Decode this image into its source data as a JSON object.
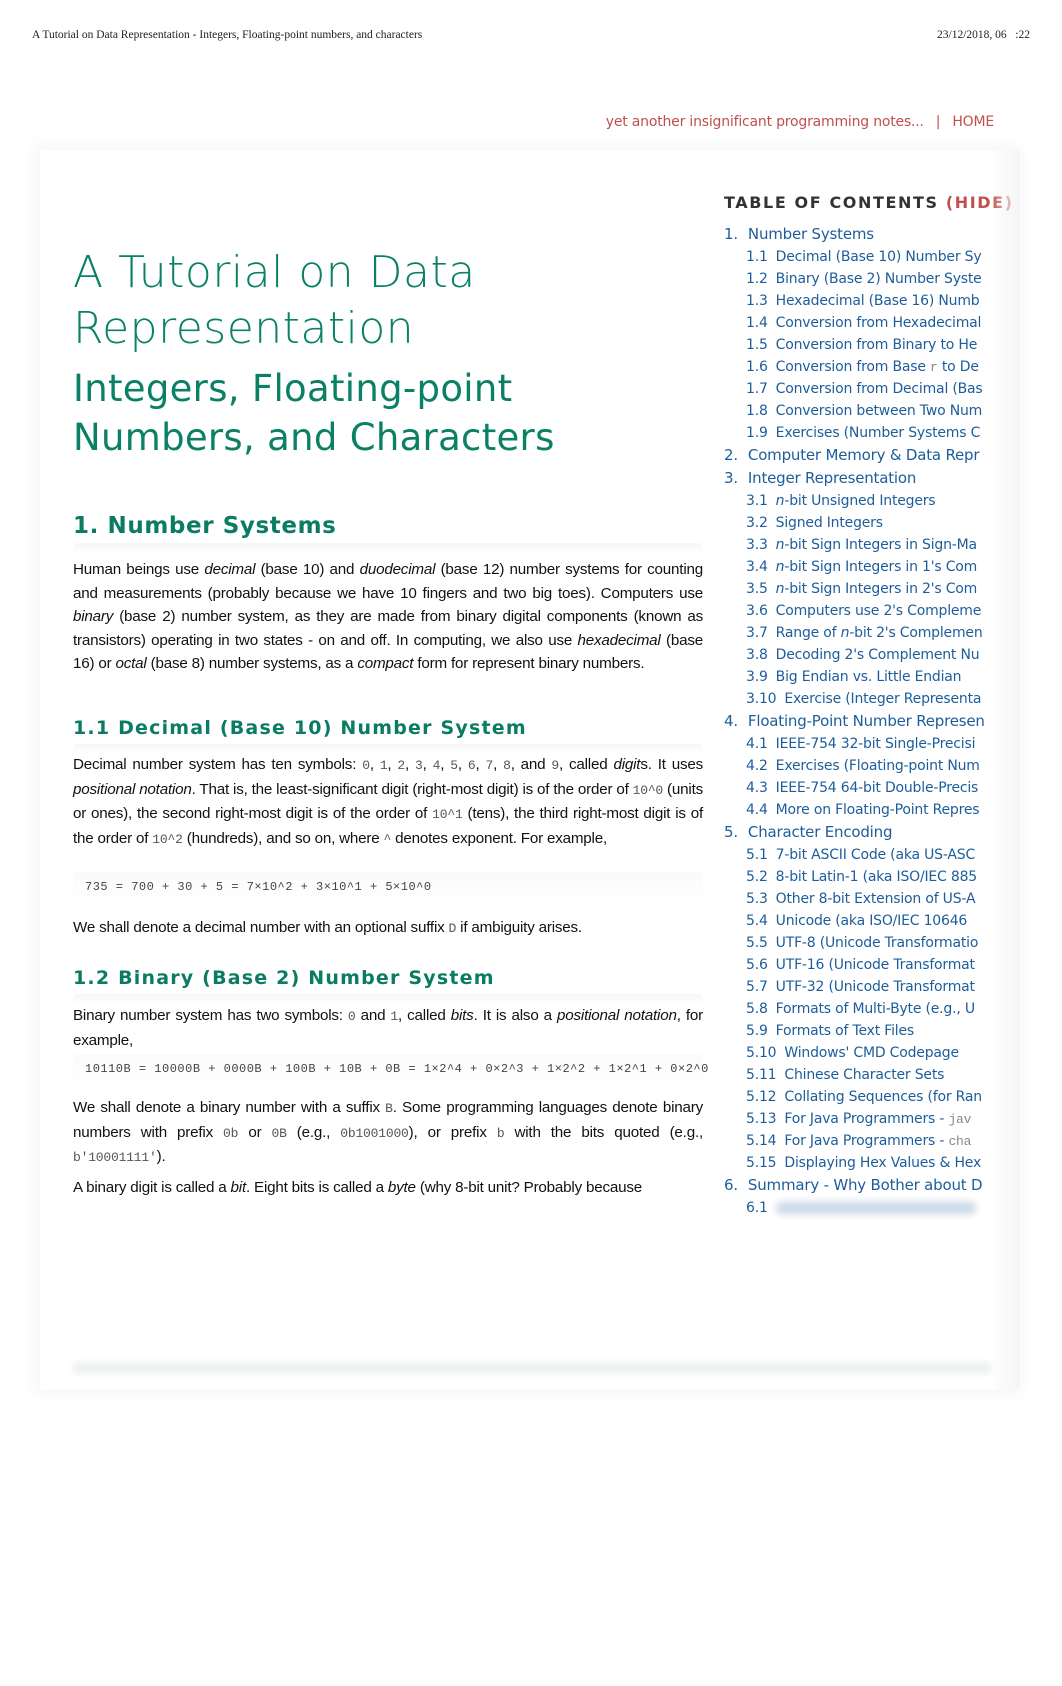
{
  "print_header": {
    "title": "A Tutorial on Data Representation - Integers, Floating-point numbers, and characters",
    "date": "23/12/2018, 06   :22"
  },
  "site_bar": {
    "tagline": "yet another insignificant programming notes...",
    "separator": "|",
    "home": "HOME"
  },
  "doc": {
    "title_line1": "A Tutorial on Data",
    "title_line2": "Representation",
    "subtitle_line1": "Integers, Floating-point",
    "subtitle_line2": "Numbers, and Characters"
  },
  "sections": {
    "s1": {
      "heading": "1.  Number Systems",
      "para": [
        {
          "t": "Human beings use "
        },
        {
          "i": "decimal"
        },
        {
          "t": " (base 10) and "
        },
        {
          "i": "duodecimal"
        },
        {
          "t": " (base 12) number systems for counting and measurements (probably because we have 10 fingers and two big toes). Computers use "
        },
        {
          "i": "binary"
        },
        {
          "t": " (base 2) number system, as they are made from binary digital components (known as transistors) operating in two states - on and off. In computing, we also use "
        },
        {
          "i": "hexadecimal"
        },
        {
          "t": " (base 16) or "
        },
        {
          "i": "octal"
        },
        {
          "t": " (base 8) number systems, as a "
        },
        {
          "i": "compact"
        },
        {
          "t": " form for represent binary numbers."
        }
      ]
    },
    "s1_1": {
      "heading": "1.1  Decimal (Base 10) Number System",
      "para": [
        {
          "t": "Decimal number system has ten symbols: "
        },
        {
          "c": "0"
        },
        {
          "t": ", "
        },
        {
          "c": "1"
        },
        {
          "t": ", "
        },
        {
          "c": "2"
        },
        {
          "t": ", "
        },
        {
          "c": "3"
        },
        {
          "t": ", "
        },
        {
          "c": "4"
        },
        {
          "t": ", "
        },
        {
          "c": "5"
        },
        {
          "t": ", "
        },
        {
          "c": "6"
        },
        {
          "t": ", "
        },
        {
          "c": "7"
        },
        {
          "t": ", "
        },
        {
          "c": "8"
        },
        {
          "t": ", and "
        },
        {
          "c": "9"
        },
        {
          "t": ", called "
        },
        {
          "i": "digit"
        },
        {
          "t": "s. It uses "
        },
        {
          "i": "positional notation"
        },
        {
          "t": ". That is, the least-significant digit (right-most digit) is of the order of "
        },
        {
          "c": "10^0"
        },
        {
          "t": " (units or ones), the second right-most digit is of the order of "
        },
        {
          "c": "10^1"
        },
        {
          "t": " (tens), the third right-most digit is of the order of "
        },
        {
          "c": "10^2"
        },
        {
          "t": " (hundreds), and so on, where "
        },
        {
          "c": "^"
        },
        {
          "t": " denotes exponent. For example,"
        }
      ],
      "code": "735 = 700 + 30 + 5 = 7×10^2 + 3×10^1 + 5×10^0",
      "para2": [
        {
          "t": "We shall denote a decimal number with an optional suffix "
        },
        {
          "c": "D"
        },
        {
          "t": " if ambiguity arises."
        }
      ]
    },
    "s1_2": {
      "heading": "1.2  Binary (Base 2) Number System",
      "para": [
        {
          "t": "Binary number system has two symbols: "
        },
        {
          "c": "0"
        },
        {
          "t": " and "
        },
        {
          "c": "1"
        },
        {
          "t": ", called "
        },
        {
          "i": "bits"
        },
        {
          "t": ". It is also a "
        },
        {
          "i": "positional notation"
        },
        {
          "t": ", for example,"
        }
      ],
      "code": "10110B = 10000B + 0000B + 100B + 10B + 0B = 1×2^4 + 0×2^3 + 1×2^2 + 1×2^1 + 0×2^0",
      "para2": [
        {
          "t": "We shall denote a binary number with a suffix "
        },
        {
          "c": "B"
        },
        {
          "t": ". Some programming languages denote binary numbers with prefix "
        },
        {
          "c": "0b"
        },
        {
          "t": " or "
        },
        {
          "c": "0B"
        },
        {
          "t": " (e.g., "
        },
        {
          "c": "0b1001000"
        },
        {
          "t": "), or prefix "
        },
        {
          "c": "b"
        },
        {
          "t": " with the bits quoted (e.g., "
        },
        {
          "c": "b'10001111'"
        },
        {
          "t": ")."
        }
      ],
      "para3": [
        {
          "t": "A binary digit is called a "
        },
        {
          "i": "bit"
        },
        {
          "t": ". Eight bits is called a "
        },
        {
          "i": "byte"
        },
        {
          "t": " (why 8-bit unit? Probably because"
        }
      ]
    }
  },
  "toc": {
    "title": "TABLE OF CONTENTS",
    "hide": "(HIDE)",
    "items": [
      {
        "level": 1,
        "num": "1.",
        "label": "Number Systems"
      },
      {
        "level": 2,
        "num": "1.1",
        "label": "Decimal (Base 10) Number Sy"
      },
      {
        "level": 2,
        "num": "1.2",
        "label": "Binary (Base 2) Number Syste"
      },
      {
        "level": 2,
        "num": "1.3",
        "label": "Hexadecimal (Base 16) Numb"
      },
      {
        "level": 2,
        "num": "1.4",
        "label": "Conversion from Hexadecimal"
      },
      {
        "level": 2,
        "num": "1.5",
        "label": "Conversion from Binary to He"
      },
      {
        "level": 2,
        "num": "1.6",
        "label": "Conversion from Base ",
        "code": "r",
        "after": " to De"
      },
      {
        "level": 2,
        "num": "1.7",
        "label": "Conversion from Decimal (Bas"
      },
      {
        "level": 2,
        "num": "1.8",
        "label": "Conversion between Two Num"
      },
      {
        "level": 2,
        "num": "1.9",
        "label": "Exercises (Number Systems C"
      },
      {
        "level": 1,
        "num": "2.",
        "label": "Computer Memory & Data Repr"
      },
      {
        "level": 1,
        "num": "3.",
        "label": "Integer Representation"
      },
      {
        "level": 2,
        "num": "3.1",
        "italic": "n",
        "label": "-bit Unsigned Integers"
      },
      {
        "level": 2,
        "num": "3.2",
        "label": "Signed Integers"
      },
      {
        "level": 2,
        "num": "3.3",
        "italic": "n",
        "label": "-bit Sign Integers in Sign-Ma"
      },
      {
        "level": 2,
        "num": "3.4",
        "italic": "n",
        "label": "-bit Sign Integers in 1's Com"
      },
      {
        "level": 2,
        "num": "3.5",
        "italic": "n",
        "label": "-bit Sign Integers in 2's Com"
      },
      {
        "level": 2,
        "num": "3.6",
        "label": "Computers use 2's Compleme"
      },
      {
        "level": 2,
        "num": "3.7",
        "label": "Range of ",
        "italic2": "n",
        "after": "-bit 2's Complemen"
      },
      {
        "level": 2,
        "num": "3.8",
        "label": "Decoding 2's Complement Nu"
      },
      {
        "level": 2,
        "num": "3.9",
        "label": "Big Endian vs. Little Endian"
      },
      {
        "level": 2,
        "num": "3.10",
        "label": "Exercise (Integer Representa"
      },
      {
        "level": 1,
        "num": "4.",
        "label": "Floating-Point Number Represen"
      },
      {
        "level": 2,
        "num": "4.1",
        "label": "IEEE-754 32-bit Single-Precisi"
      },
      {
        "level": 2,
        "num": "4.2",
        "label": "Exercises (Floating-point Num"
      },
      {
        "level": 2,
        "num": "4.3",
        "label": "IEEE-754 64-bit Double-Precis"
      },
      {
        "level": 2,
        "num": "4.4",
        "label": "More on Floating-Point Repres"
      },
      {
        "level": 1,
        "num": "5.",
        "label": "Character Encoding"
      },
      {
        "level": 2,
        "num": "5.1",
        "label": "7-bit ASCII Code (aka US-ASC"
      },
      {
        "level": 2,
        "num": "5.2",
        "label": "8-bit Latin-1 (aka ISO/IEC 885"
      },
      {
        "level": 2,
        "num": "5.3",
        "label": "Other 8-bit Extension of US-A"
      },
      {
        "level": 2,
        "num": "5.4",
        "label": "Unicode (aka ISO/IEC 10646"
      },
      {
        "level": 2,
        "num": "5.5",
        "label": "UTF-8 (Unicode Transformatio"
      },
      {
        "level": 2,
        "num": "5.6",
        "label": "UTF-16 (Unicode Transformat"
      },
      {
        "level": 2,
        "num": "5.7",
        "label": "UTF-32 (Unicode Transformat"
      },
      {
        "level": 2,
        "num": "5.8",
        "label": "Formats of Multi-Byte (e.g., U"
      },
      {
        "level": 2,
        "num": "5.9",
        "label": "Formats of Text Files"
      },
      {
        "level": 2,
        "num": "5.10",
        "label": "Windows' CMD Codepage"
      },
      {
        "level": 2,
        "num": "5.11",
        "label": "Chinese Character Sets"
      },
      {
        "level": 2,
        "num": "5.12",
        "label": "Collating Sequences (for Ran"
      },
      {
        "level": 2,
        "num": "5.13",
        "label": "For Java Programmers - ",
        "code": "jav"
      },
      {
        "level": 2,
        "num": "5.14",
        "label": "For Java Programmers - ",
        "code": "cha"
      },
      {
        "level": 2,
        "num": "5.15",
        "label": "Displaying Hex Values & Hex"
      },
      {
        "level": 1,
        "num": "6.",
        "label": "Summary - Why Bother about D"
      },
      {
        "level": 2,
        "num": "6.1",
        "label": "",
        "blurred": true
      }
    ]
  }
}
